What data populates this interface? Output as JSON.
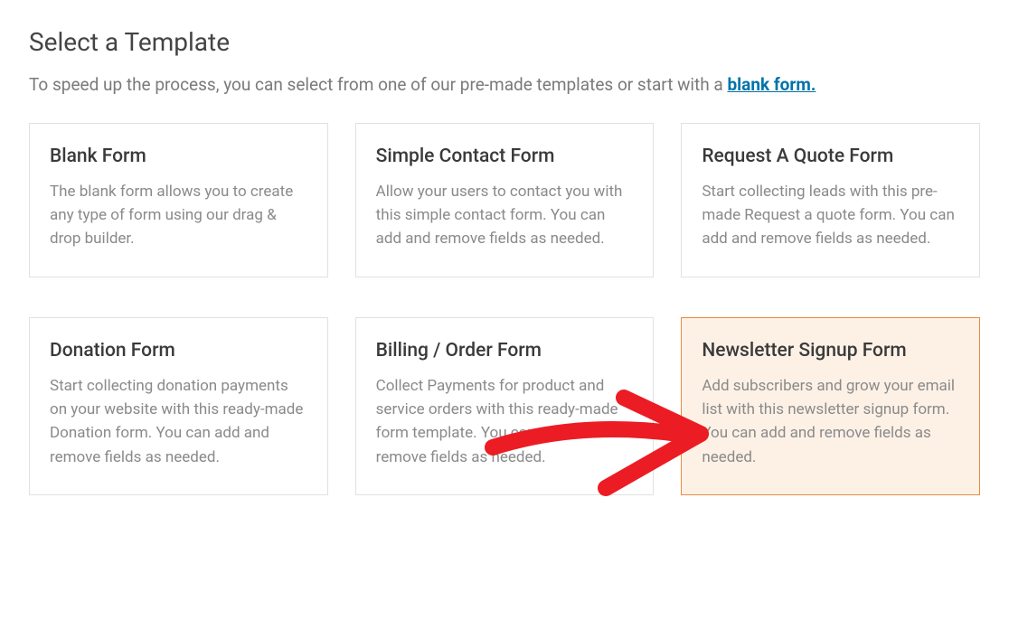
{
  "header": {
    "title": "Select a Template",
    "subtitle_prefix": "To speed up the process, you can select from one of our pre-made templates or start with a ",
    "blank_link": "blank form."
  },
  "templates": [
    {
      "title": "Blank Form",
      "desc": "The blank form allows you to create any type of form using our drag & drop builder."
    },
    {
      "title": "Simple Contact Form",
      "desc": "Allow your users to contact you with this simple contact form. You can add and remove fields as needed."
    },
    {
      "title": "Request A Quote Form",
      "desc": "Start collecting leads with this pre-made Request a quote form. You can add and remove fields as needed."
    },
    {
      "title": "Donation Form",
      "desc": "Start collecting donation payments on your website with this ready-made Donation form. You can add and remove fields as needed."
    },
    {
      "title": "Billing / Order Form",
      "desc": "Collect Payments for product and service orders with this ready-made form template. You can add and remove fields as needed."
    },
    {
      "title": "Newsletter Signup Form",
      "desc": "Add subscribers and grow your email list with this newsletter signup form. You can add and remove fields as needed."
    }
  ]
}
